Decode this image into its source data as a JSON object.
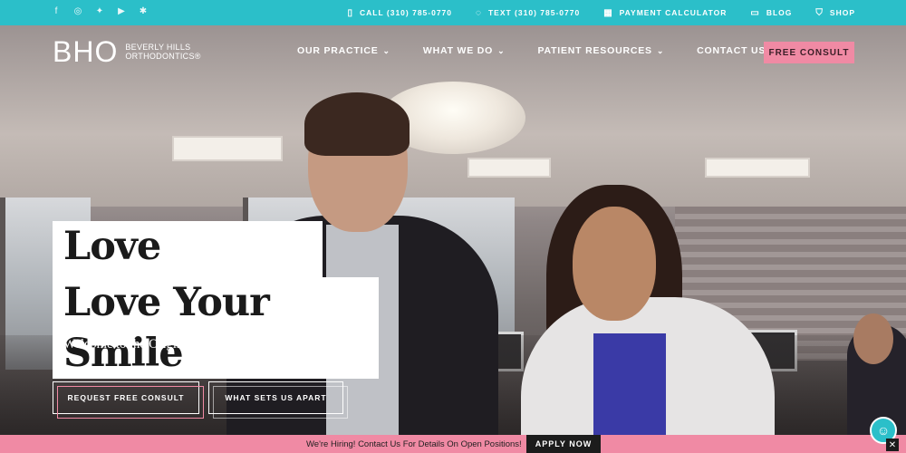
{
  "topbar": {
    "social": [
      {
        "icon": "facebook-icon",
        "glyph": "f"
      },
      {
        "icon": "instagram-icon",
        "glyph": "◎"
      },
      {
        "icon": "twitter-icon",
        "glyph": "✦"
      },
      {
        "icon": "youtube-icon",
        "glyph": "▶"
      },
      {
        "icon": "yelp-icon",
        "glyph": "✱"
      }
    ],
    "call": {
      "icon": "phone-icon",
      "label": "CALL (310) 785-0770"
    },
    "text": {
      "icon": "chat-bubble-icon",
      "label": "TEXT (310) 785-0770"
    },
    "calculator": {
      "icon": "calculator-icon",
      "label": "PAYMENT CALCULATOR"
    },
    "blog": {
      "icon": "blog-icon",
      "label": "BLOG"
    },
    "shop": {
      "icon": "shopping-bag-icon",
      "label": "SHOP"
    }
  },
  "logo": {
    "mark": "BHO",
    "line1": "BEVERLY HILLS",
    "line2": "ORTHODONTICS®"
  },
  "nav": {
    "items": [
      "OUR PRACTICE",
      "WHAT WE DO",
      "PATIENT RESOURCES",
      "CONTACT US"
    ],
    "cta": "FREE CONSULT"
  },
  "hero": {
    "headline1": "Love Yourself",
    "headline2": "Love Your Smile",
    "welcome_prefix": "Welcome to the Original ",
    "welcome_brand": "Beverly Hills Orthodontics",
    "welcome_mark": "®",
    "cta_primary": "REQUEST FREE CONSULT",
    "cta_secondary": "WHAT SETS US APART"
  },
  "banner": {
    "message": "We're Hiring! Contact Us For Details On Open Positions!",
    "apply": "APPLY NOW",
    "close": "✕"
  },
  "chat": {
    "icon": "chat-icon",
    "glyph": "☺"
  },
  "colors": {
    "teal": "#2bbfc9",
    "pink": "#f08aa4",
    "dark": "#1c1c1c"
  }
}
